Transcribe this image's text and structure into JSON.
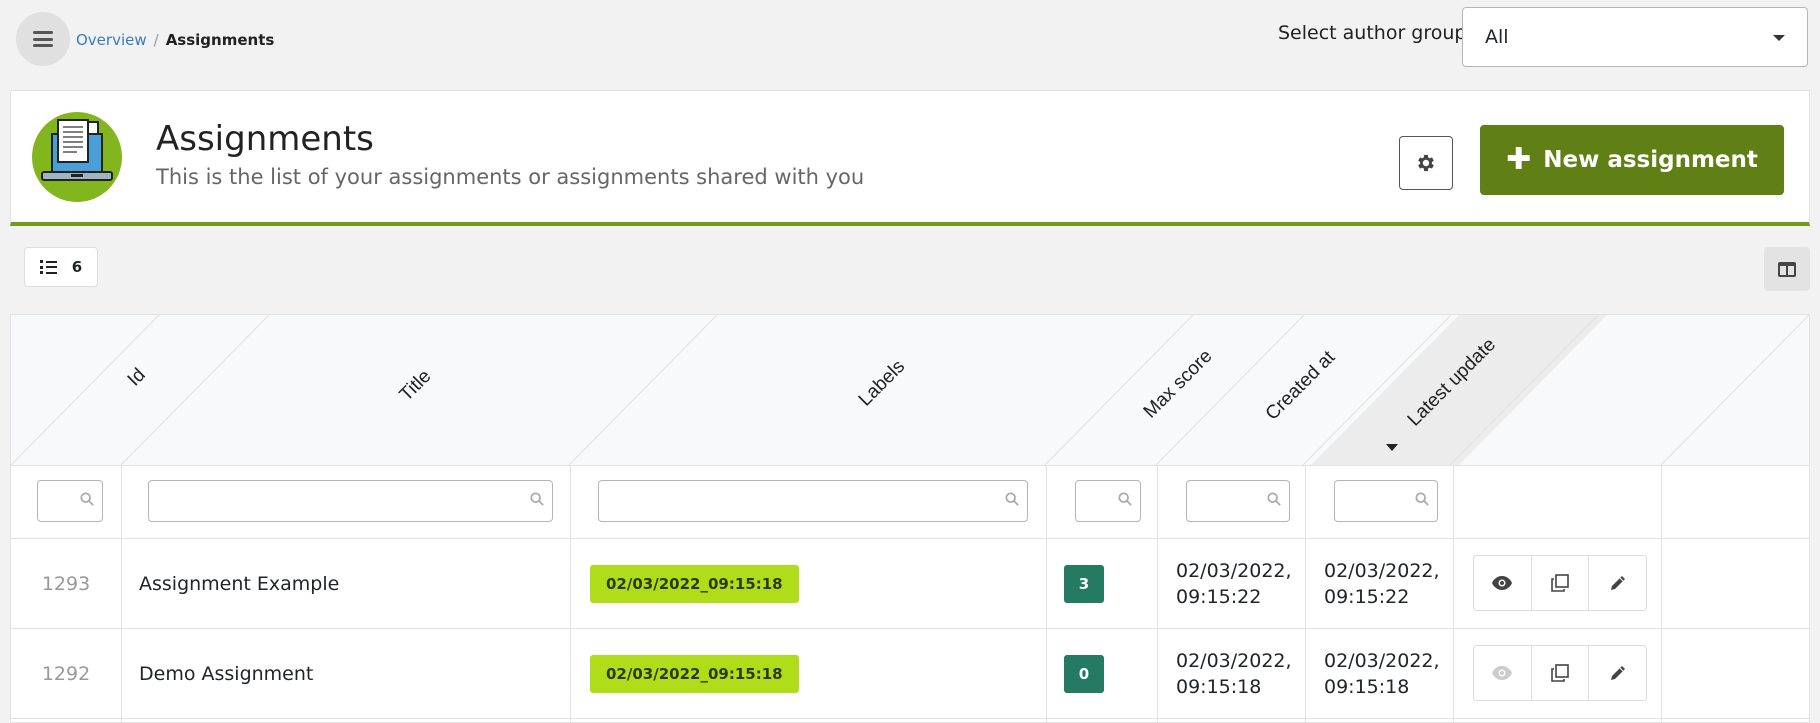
{
  "breadcrumb": {
    "parent": "Overview",
    "separator": "/",
    "current": "Assignments"
  },
  "author_group": {
    "label": "Select author group",
    "selected": "All"
  },
  "header": {
    "title": "Assignments",
    "subtitle": "This is the list of your assignments or assignments shared with you",
    "new_button_label": "New assignment"
  },
  "toolbar": {
    "count": "6"
  },
  "table": {
    "columns": [
      "Id",
      "Title",
      "Labels",
      "Max score",
      "Created at",
      "Latest update"
    ],
    "sorted_column": "Latest update",
    "sort_direction": "desc",
    "rows": [
      {
        "id": "1293",
        "title": "Assignment Example",
        "label": "02/03/2022_09:15:18",
        "max_score": "3",
        "created_at_date": "02/03/2022,",
        "created_at_time": "09:15:22",
        "updated_date": "02/03/2022,",
        "updated_time": "09:15:22",
        "view_enabled": true
      },
      {
        "id": "1292",
        "title": "Demo Assignment",
        "label": "02/03/2022_09:15:18",
        "max_score": "0",
        "created_at_date": "02/03/2022,",
        "created_at_time": "09:15:18",
        "updated_date": "02/03/2022,",
        "updated_time": "09:15:18",
        "view_enabled": false
      }
    ]
  },
  "colors": {
    "accent": "#607f14",
    "label_badge": "#b0dd1a",
    "score_badge": "#257a62",
    "link": "#3a7bbf"
  },
  "icons": {
    "menu": "hamburger-icon",
    "settings": "gear-icon",
    "add": "plus-icon",
    "count": "list-icon",
    "columns": "columns-icon",
    "search": "search-icon",
    "view": "eye-icon",
    "copy": "copy-icon",
    "edit": "pencil-icon",
    "sort": "caret-down-icon"
  }
}
